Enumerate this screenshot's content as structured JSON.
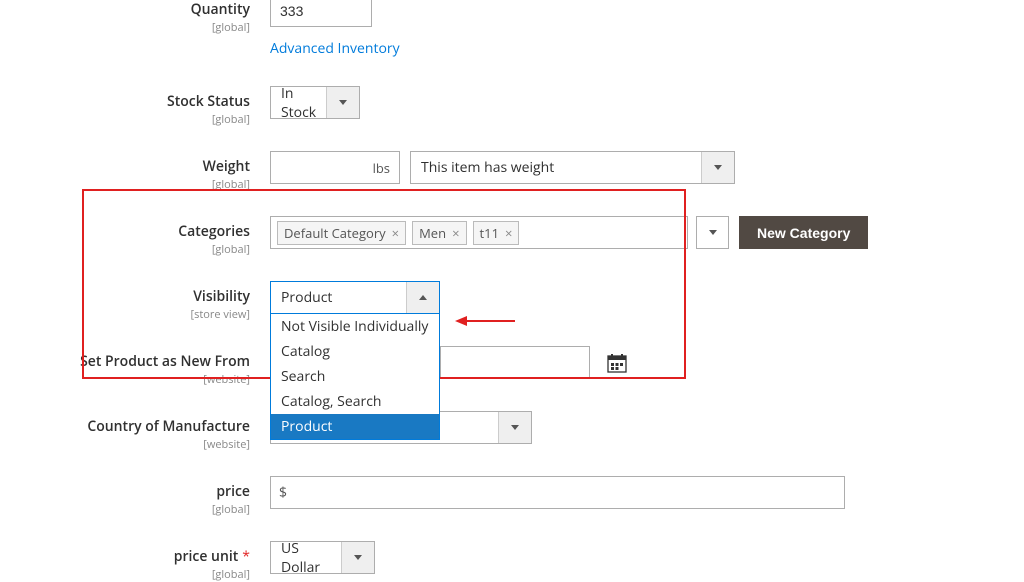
{
  "quantity": {
    "label": "Quantity",
    "scope": "[global]",
    "value": "333",
    "advanced_link": "Advanced Inventory"
  },
  "stock": {
    "label": "Stock Status",
    "scope": "[global]",
    "value": "In Stock"
  },
  "weight": {
    "label": "Weight",
    "scope": "[global]",
    "value": "",
    "suffix": "lbs",
    "option": "This item has weight"
  },
  "categories": {
    "label": "Categories",
    "scope": "[global]",
    "chips": [
      "Default Category",
      "Men",
      "t11"
    ],
    "new_button": "New Category"
  },
  "visibility": {
    "label": "Visibility",
    "scope": "[store view]",
    "value": "Product",
    "options": [
      "Not Visible Individually",
      "Catalog",
      "Search",
      "Catalog, Search",
      "Product"
    ]
  },
  "newfrom": {
    "label": "Set Product as New From",
    "scope": "[website]",
    "value": ""
  },
  "country": {
    "label": "Country of Manufacture",
    "scope": "[website]",
    "value": ""
  },
  "price": {
    "label": "price",
    "scope": "[global]",
    "currency": "$",
    "value": ""
  },
  "price_unit": {
    "label": "price unit",
    "scope": "[global]",
    "value": "US Dollar"
  }
}
